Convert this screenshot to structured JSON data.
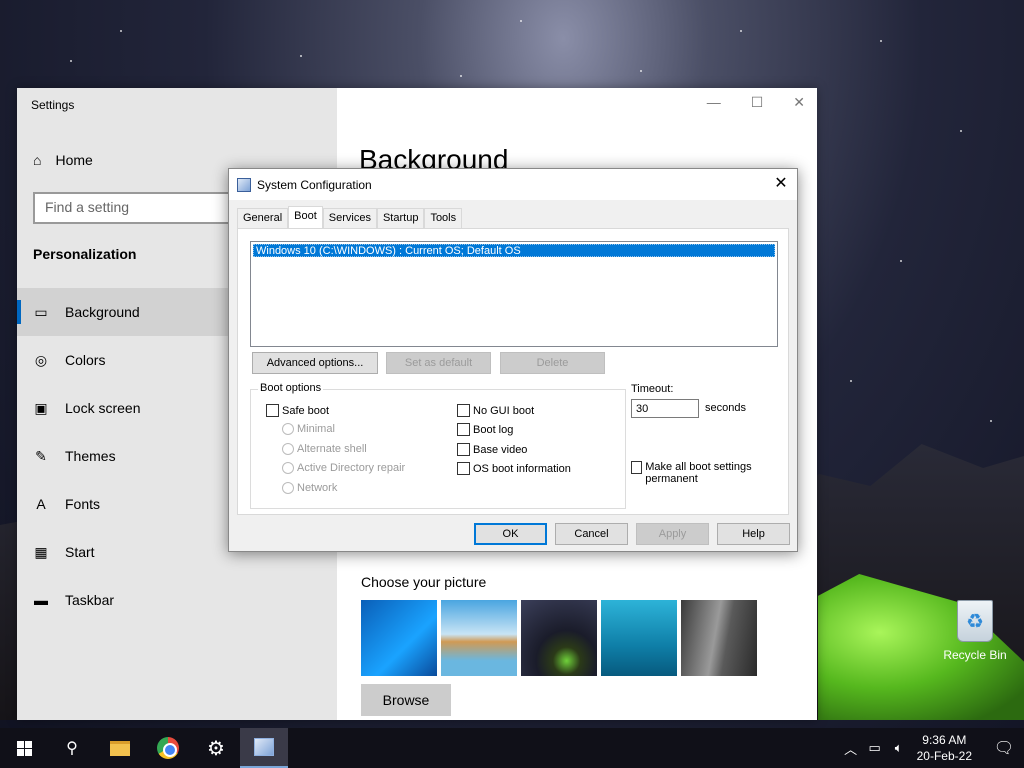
{
  "settings": {
    "app_title": "Settings",
    "home_label": "Home",
    "search_placeholder": "Find a setting",
    "section_heading": "Personalization",
    "nav": [
      {
        "label": "Background",
        "icon": "image-icon"
      },
      {
        "label": "Colors",
        "icon": "palette-icon"
      },
      {
        "label": "Lock screen",
        "icon": "lock-screen-icon"
      },
      {
        "label": "Themes",
        "icon": "themes-icon"
      },
      {
        "label": "Fonts",
        "icon": "fonts-icon"
      },
      {
        "label": "Start",
        "icon": "start-icon"
      },
      {
        "label": "Taskbar",
        "icon": "taskbar-icon"
      }
    ],
    "page_title": "Background",
    "choose_picture_label": "Choose your picture",
    "browse_label": "Browse",
    "accent_color": "#0067c0"
  },
  "dialog": {
    "title": "System Configuration",
    "tabs": [
      "General",
      "Boot",
      "Services",
      "Startup",
      "Tools"
    ],
    "active_tab": "Boot",
    "os_entries": [
      "Windows 10 (C:\\WINDOWS) : Current OS; Default OS"
    ],
    "buttons": {
      "advanced": "Advanced options...",
      "set_default": "Set as default",
      "delete": "Delete",
      "ok": "OK",
      "cancel": "Cancel",
      "apply": "Apply",
      "help": "Help"
    },
    "boot_options_label": "Boot options",
    "safe_boot_label": "Safe boot",
    "safe_boot_modes": [
      "Minimal",
      "Alternate shell",
      "Active Directory repair",
      "Network"
    ],
    "right_options": [
      "No GUI boot",
      "Boot log",
      "Base video",
      "OS boot information"
    ],
    "timeout_label": "Timeout:",
    "timeout_value": "30",
    "seconds_label": "seconds",
    "make_permanent_label": "Make all boot settings permanent",
    "selection_color": "#0078d7"
  },
  "desktop": {
    "recycle_bin_label": "Recycle Bin"
  },
  "taskbar": {
    "time": "9:36 AM",
    "date": "20-Feb-22"
  }
}
